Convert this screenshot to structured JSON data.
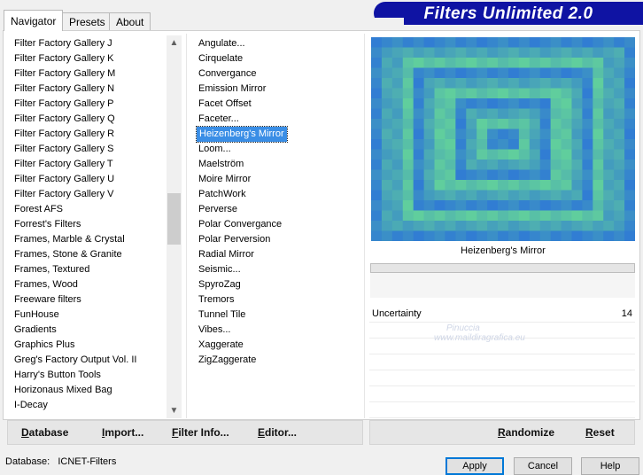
{
  "tabs": [
    "Navigator",
    "Presets",
    "About"
  ],
  "banner_title": "Filters Unlimited 2.0",
  "categories": [
    "Filter Factory Gallery J",
    "Filter Factory Gallery K",
    "Filter Factory Gallery M",
    "Filter Factory Gallery N",
    "Filter Factory Gallery P",
    "Filter Factory Gallery Q",
    "Filter Factory Gallery R",
    "Filter Factory Gallery S",
    "Filter Factory Gallery T",
    "Filter Factory Gallery U",
    "Filter Factory Gallery V",
    "Forest AFS",
    "Forrest's Filters",
    "Frames, Marble & Crystal",
    "Frames, Stone & Granite",
    "Frames, Textured",
    "Frames, Wood",
    "Freeware filters",
    "FunHouse",
    "Gradients",
    "Graphics Plus",
    "Greg's Factory Output Vol. II",
    "Harry's Button Tools",
    "Horizonaus Mixed Bag",
    "I-Decay"
  ],
  "filters": [
    "Angulate...",
    "Cirquelate",
    "Convergance",
    "Emission Mirror",
    "Facet Offset",
    "Faceter...",
    "Heizenberg's Mirror",
    "Loom...",
    "Maelström",
    "Moire Mirror",
    "PatchWork",
    "Perverse",
    "Polar Convergance",
    "Polar Perversion",
    "Radial Mirror",
    "Seismic...",
    "SpyroZag",
    "Tremors",
    "Tunnel Tile",
    "Vibes...",
    "Xaggerate",
    "ZigZaggerate"
  ],
  "selected_filter_index": 6,
  "preview_caption": "Heizenberg's Mirror",
  "parameter": {
    "label": "Uncertainty",
    "value": "14"
  },
  "watermark": {
    "line1": "Pinuccia",
    "line2": "www.maildiragrafica.eu"
  },
  "left_buttons": [
    {
      "key": "D",
      "rest": "atabase"
    },
    {
      "key": "I",
      "rest": "mport..."
    },
    {
      "key": "F",
      "rest": "ilter Info..."
    },
    {
      "key": "E",
      "rest": "ditor..."
    }
  ],
  "right_buttons": [
    {
      "key": "R",
      "rest": "andomize"
    },
    {
      "key": "R",
      "rest": "eset"
    }
  ],
  "status": {
    "label": "Database:",
    "value": "ICNET-Filters"
  },
  "dialog_buttons": [
    "Apply",
    "Cancel",
    "Help"
  ],
  "colors": {
    "banner": "#0f13a3",
    "selection": "#3a8ee6",
    "preview_a": "#2e78d6",
    "preview_b": "#63d29a"
  }
}
